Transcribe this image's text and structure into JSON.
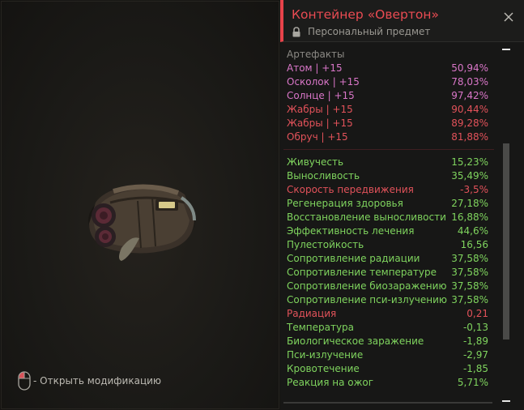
{
  "item": {
    "title": "Контейнер «Овертон»",
    "subtitle": "Персональный предмет",
    "icons": {
      "lock": "lock-icon",
      "close": "close-icon",
      "mouse": "mouse-icon"
    }
  },
  "hint": {
    "text": "- Открыть модификацию"
  },
  "artifacts": {
    "header": "Артефакты",
    "rows": [
      {
        "name": "Атом | +15",
        "value": "50,94%",
        "color": "#d976c8"
      },
      {
        "name": "Осколок | +15",
        "value": "78,03%",
        "color": "#d976c8"
      },
      {
        "name": "Солнце | +15",
        "value": "97,42%",
        "color": "#d976c8"
      },
      {
        "name": "Жабры | +15",
        "value": "90,44%",
        "color": "#e2525a"
      },
      {
        "name": "Жабры | +15",
        "value": "89,28%",
        "color": "#e2525a"
      },
      {
        "name": "Обруч | +15",
        "value": "81,88%",
        "color": "#e2525a"
      }
    ]
  },
  "stats": {
    "rows": [
      {
        "name": "Живучесть",
        "value": "15,23%",
        "color": "#7fd45e"
      },
      {
        "name": "Выносливость",
        "value": "35,49%",
        "color": "#7fd45e"
      },
      {
        "name": "Скорость передвижения",
        "value": "-3,5%",
        "color": "#e2525a"
      },
      {
        "name": "Регенерация здоровья",
        "value": "27,18%",
        "color": "#7fd45e"
      },
      {
        "name": "Восстановление выносливости",
        "value": "16,88%",
        "color": "#7fd45e"
      },
      {
        "name": "Эффективность лечения",
        "value": "44,6%",
        "color": "#7fd45e"
      },
      {
        "name": "Пулестойкость",
        "value": "16,56",
        "color": "#7fd45e"
      },
      {
        "name": "Сопротивление радиации",
        "value": "37,58%",
        "color": "#7fd45e"
      },
      {
        "name": "Сопротивление температуре",
        "value": "37,58%",
        "color": "#7fd45e"
      },
      {
        "name": "Сопротивление биозаражению",
        "value": "37,58%",
        "color": "#7fd45e"
      },
      {
        "name": "Сопротивление пси-излучению",
        "value": "37,58%",
        "color": "#7fd45e"
      },
      {
        "name": "Радиация",
        "value": "0,21",
        "color": "#e2525a"
      },
      {
        "name": "Температура",
        "value": "-0,13",
        "color": "#7fd45e"
      },
      {
        "name": "Биологическое заражение",
        "value": "-1,89",
        "color": "#7fd45e"
      },
      {
        "name": "Пси-излучение",
        "value": "-2,97",
        "color": "#7fd45e"
      },
      {
        "name": "Кровотечение",
        "value": "-1,85",
        "color": "#7fd45e"
      },
      {
        "name": "Реакция на ожог",
        "value": "5,71%",
        "color": "#7fd45e"
      }
    ]
  },
  "colors": {
    "accent": "#e94b52",
    "positive": "#7fd45e",
    "negative": "#e2525a",
    "rare": "#d976c8"
  }
}
